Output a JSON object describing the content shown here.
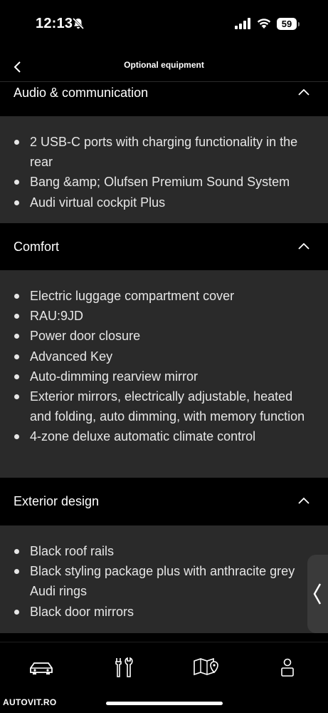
{
  "status_bar": {
    "time": "12:13",
    "battery": "59"
  },
  "nav": {
    "title": "Optional equipment"
  },
  "sections": [
    {
      "title": "Audio & communication",
      "items": [
        "2 USB-C ports with charging functionality in the rear",
        "Bang &amp; Olufsen Premium Sound System",
        "Audi virtual cockpit Plus"
      ]
    },
    {
      "title": "Comfort",
      "items": [
        "Electric luggage compartment cover",
        "RAU:9JD",
        "Power door closure",
        "Advanced Key",
        "Auto-dimming rearview mirror",
        "Exterior mirrors, electrically adjustable, heated and folding, auto dimming, with memory function",
        "4-zone deluxe automatic climate control"
      ]
    },
    {
      "title": "Exterior design",
      "items": [
        "Black roof rails",
        "Black styling package plus with anthracite grey Audi rings",
        "Black door mirrors"
      ]
    }
  ],
  "tab_bar": {
    "icons": [
      "car-icon",
      "tools-icon",
      "map-icon",
      "profile-icon"
    ]
  },
  "watermark": "AUTOVIT.RO"
}
